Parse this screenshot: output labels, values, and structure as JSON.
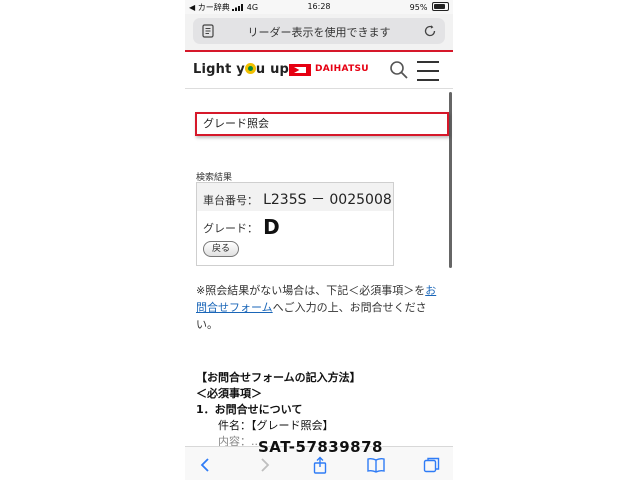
{
  "status_bar": {
    "carrier": "◀ カー辞典",
    "network": "4G",
    "time": "16:28",
    "battery": "95%",
    "battery_level": 0.95
  },
  "browser": {
    "reader_prompt": "リーダー表示を使用できます"
  },
  "site": {
    "logo_text_a": "Light y",
    "logo_text_b": "u up",
    "brand_name": "DAIHATSU"
  },
  "content": {
    "section_title": "グレード照会",
    "results_label": "検索結果",
    "chassis_label": "車台番号：",
    "chassis_value": "L235S － 0025008",
    "grade_label": "グレード：",
    "grade_value": "D",
    "back_label": "戻る",
    "notice_pre": "※照会結果がない場合は、下記＜必須事項＞をお問合せフォーム",
    "notice_link": "お問合せフォーム",
    "notice_post": "へご入力の上、お問合せください。",
    "howto_heading": "【お問合せフォームの記入方法】",
    "required_heading": "＜必須事項＞",
    "item1_heading": "1．お問合せについて",
    "subject_label": "件名：【グレード照会】",
    "content_label_partial": "内容：..."
  },
  "watermark": "SAT-57839878",
  "colors": {
    "accent_red": "#d6182a",
    "brand_red": "#e60012",
    "link_blue": "#1a66b8",
    "toolbar_blue": "#2f7cf6"
  }
}
